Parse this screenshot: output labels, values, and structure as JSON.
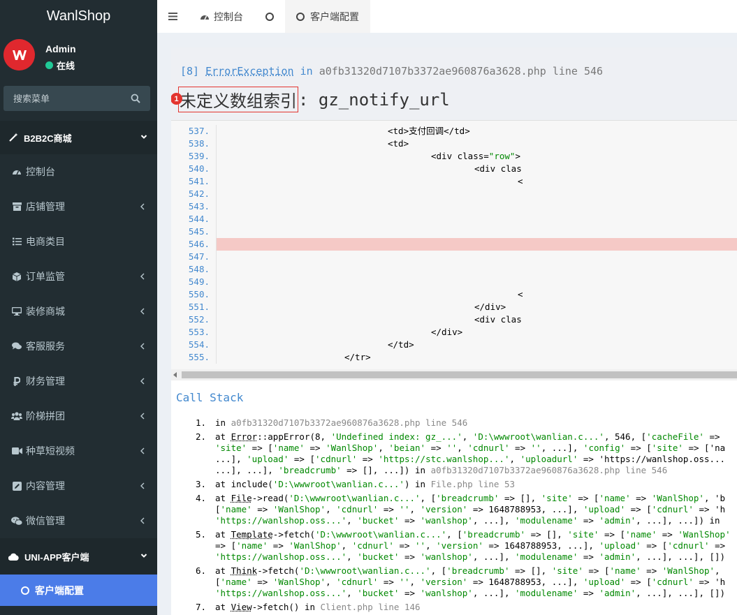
{
  "app": {
    "brand": "WanlShop"
  },
  "user": {
    "name": "Admin",
    "status": "在线"
  },
  "search": {
    "placeholder": "搜索菜单"
  },
  "menu": {
    "group1": "B2B2C商城",
    "items": [
      {
        "label": "控制台",
        "icon": "dashboard-icon",
        "arrow": false
      },
      {
        "label": "店铺管理",
        "icon": "archive-icon",
        "arrow": true
      },
      {
        "label": "电商类目",
        "icon": "list-icon",
        "arrow": false
      },
      {
        "label": "订单监管",
        "icon": "cube-icon",
        "arrow": true
      },
      {
        "label": "装修商城",
        "icon": "desktop-icon",
        "arrow": true
      },
      {
        "label": "客服服务",
        "icon": "comments-icon",
        "arrow": true
      },
      {
        "label": "财务管理",
        "icon": "ruble-icon",
        "arrow": true
      },
      {
        "label": "阶梯拼团",
        "icon": "users-icon",
        "arrow": true
      },
      {
        "label": "种草短视频",
        "icon": "video-camera-icon",
        "arrow": true
      },
      {
        "label": "内容管理",
        "icon": "edit-icon",
        "arrow": true
      },
      {
        "label": "微信管理",
        "icon": "wechat-icon",
        "arrow": true
      }
    ],
    "group2": "UNI-APP客户端",
    "active_sub": "客户端配置"
  },
  "tabs": [
    {
      "label": "控制台"
    },
    {
      "label": ""
    },
    {
      "label": "客户端配置"
    }
  ],
  "exception": {
    "code": "[8]",
    "type": "ErrorException",
    "in": "in",
    "file": "a0fb31320d7107b3372ae960876a3628.php",
    "line_word": "line",
    "line": "546",
    "badge": "1",
    "message_cn": "未定义数组索引",
    "message_rest": ": gz_notify_url"
  },
  "code": {
    "highlight_line": "546",
    "lines": [
      {
        "n": "537.",
        "text": "<td>支付回调</td>",
        "indent": 555
      },
      {
        "n": "538.",
        "text": "<td>",
        "indent": 555
      },
      {
        "n": "539.",
        "text": "<div class=\"row\">",
        "indent": 617
      },
      {
        "n": "540.",
        "text": "<div clas",
        "indent": 679
      },
      {
        "n": "541.",
        "text": "<",
        "indent": 741
      },
      {
        "n": "542.",
        "text": "",
        "indent": 0
      },
      {
        "n": "543.",
        "text": "",
        "indent": 0
      },
      {
        "n": "544.",
        "text": "",
        "indent": 0
      },
      {
        "n": "545.",
        "text": "",
        "indent": 0
      },
      {
        "n": "546.",
        "text": "",
        "indent": 0
      },
      {
        "n": "547.",
        "text": "",
        "indent": 0
      },
      {
        "n": "548.",
        "text": "",
        "indent": 0
      },
      {
        "n": "549.",
        "text": "",
        "indent": 0
      },
      {
        "n": "550.",
        "text": "<",
        "indent": 741
      },
      {
        "n": "551.",
        "text": "</div>",
        "indent": 679
      },
      {
        "n": "552.",
        "text": "<div clas",
        "indent": 679
      },
      {
        "n": "553.",
        "text": "</div>",
        "indent": 617
      },
      {
        "n": "554.",
        "text": "</td>",
        "indent": 555
      },
      {
        "n": "555.",
        "text": "</tr>",
        "indent": 493
      }
    ]
  },
  "stack": {
    "title": "Call Stack",
    "items": [
      {
        "num": "1.",
        "lines": [
          "in a0fb31320d7107b3372ae960876a3628.php line 546"
        ]
      },
      {
        "num": "2.",
        "lines": [
          "at Error::appError(8, 'Undefined index: gz_...', 'D:\\wwwroot\\wanlian.c...', 546, ['cacheFile' =>",
          "'site' => ['name' => 'WanlShop', 'beian' => '', 'cdnurl' => '', ...], 'config' => ['site' => ['na",
          "...], 'upload' => ['cdnurl' => 'https://stc.wanlshop...', 'uploadurl' => 'https://wanlshop.oss...",
          "...], ...], 'breadcrumb' => [], ...]) in a0fb31320d7107b3372ae960876a3628.php line 546"
        ]
      },
      {
        "num": "3.",
        "lines": [
          "at include('D:\\wwwroot\\wanlian.c...') in File.php line 53"
        ]
      },
      {
        "num": "4.",
        "lines": [
          "at File->read('D:\\wwwroot\\wanlian.c...', ['breadcrumb' => [], 'site' => ['name' => 'WanlShop', 'b",
          "['name' => 'WanlShop', 'cdnurl' => '', 'version' => 1648788953, ...], 'upload' => ['cdnurl' => 'h",
          "'https://wanlshop.oss...', 'bucket' => 'wanlshop', ...], 'modulename' => 'admin', ...], ...]) in"
        ]
      },
      {
        "num": "5.",
        "lines": [
          "at Template->fetch('D:\\wwwroot\\wanlian.c...', ['breadcrumb' => [], 'site' => ['name' => 'WanlShop'",
          "=> ['name' => 'WanlShop', 'cdnurl' => '', 'version' => 1648788953, ...], 'upload' => ['cdnurl' =>",
          "'https://wanlshop.oss...', 'bucket' => 'wanlshop', ...], 'modulename' => 'admin', ...], ...], [])"
        ]
      },
      {
        "num": "6.",
        "lines": [
          "at Think->fetch('D:\\wwwroot\\wanlian.c...', ['breadcrumb' => [], 'site' => ['name' => 'WanlShop',",
          "['name' => 'WanlShop', 'cdnurl' => '', 'version' => 1648788953, ...], 'upload' => ['cdnurl' => 'h",
          "'https://wanlshop.oss...', 'bucket' => 'wanlshop', ...], 'modulename' => 'admin', ...], ...], [])"
        ]
      },
      {
        "num": "7.",
        "lines": [
          "at View->fetch() in Client.php line 146"
        ]
      }
    ]
  },
  "colors": {
    "sidebar": "#222d32",
    "active": "#4b7ce8",
    "link": "#4288ce",
    "error": "#e3342f",
    "online": "#20c997"
  }
}
